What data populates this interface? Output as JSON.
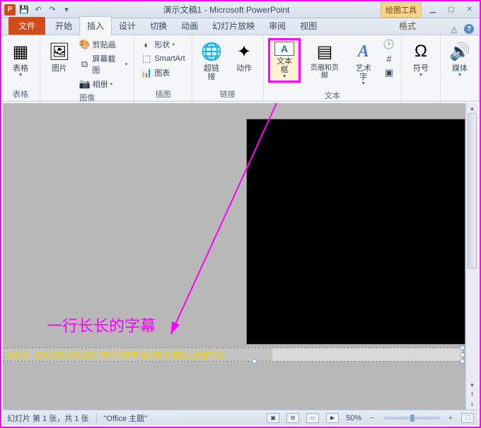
{
  "titlebar": {
    "app_initial": "P",
    "title": "演示文稿1 - Microsoft PowerPoint",
    "drawing_tools": "绘图工具"
  },
  "tabs": {
    "file": "文件",
    "items": [
      "开始",
      "插入",
      "设计",
      "切换",
      "动画",
      "幻灯片放映",
      "审阅",
      "视图"
    ],
    "format": "格式",
    "active_index": 1
  },
  "ribbon": {
    "groups": {
      "tables": {
        "label": "表格",
        "table": "表格"
      },
      "images": {
        "label": "图像",
        "picture": "图片",
        "clipart": "剪贴画",
        "screenshot": "屏幕截图",
        "album": "相册"
      },
      "illustrations": {
        "label": "插图",
        "shapes": "形状",
        "smartart": "SmartArt",
        "chart": "图表"
      },
      "links": {
        "label": "链接",
        "hyperlink": "超链接",
        "action": "动作"
      },
      "text": {
        "label": "文本",
        "textbox": "文本框",
        "header_footer": "页眉和页脚",
        "wordart": "艺术字"
      },
      "symbols": {
        "label": "符号",
        "symbol": "符号"
      },
      "media": {
        "label": "媒体",
        "media": "媒体"
      }
    }
  },
  "annotation": {
    "text": "一行长长的字幕"
  },
  "subtitle": {
    "text": "永远在一起啦啦啦啦啦啦啦 每天给我幸福给我比糖还要甜蜜的爱"
  },
  "statusbar": {
    "slide_info": "幻灯片 第 1 张，共 1 张",
    "theme": "\"Office 主题\"",
    "zoom": "50%"
  }
}
